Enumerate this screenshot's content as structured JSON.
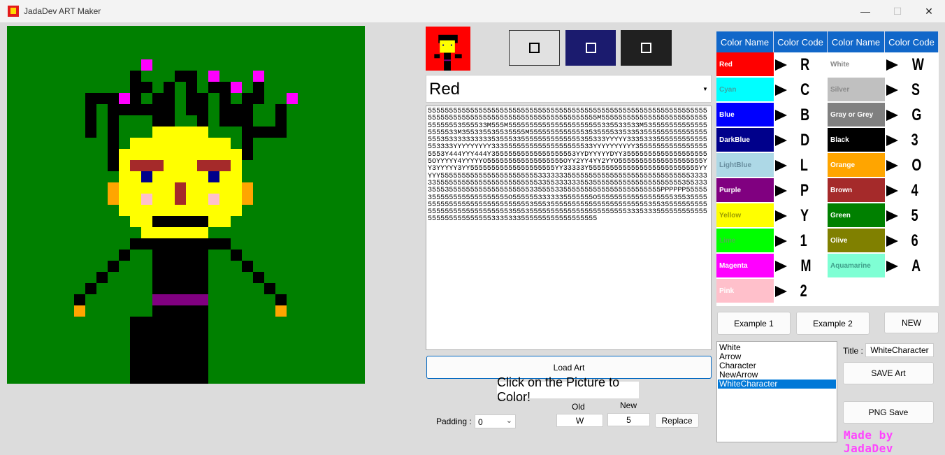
{
  "window": {
    "title": "JadaDev ART Maker",
    "controls": {
      "minimize": "—",
      "maximize": "☐",
      "close": "✕"
    }
  },
  "art": {
    "title": "WhiteCharacter",
    "background_color": "#008000",
    "code": "5555555555555555555555555555555555555555555555555555555555555555555555555555555555555555555555555555555555M555555555555555555555555555555553555533M555M5555555555555555555555335533533M5355555555555555555533M355335535535555M555555555555535355553353353555555555555555555353333333333535553355555555555555355333YYYYY3335333555555555555553333YYYYYYYYY333555555555555555555533YYYYYYYYYY355555555555555555553Y444YYY444Y35555555555555555553YYDYYYYYDYY355555555555555555555OYYYYY4YYYYYO555555555555555555OYY2YY4YY2YYO55555555555555555555YY3YYYYY3YY55555555555555555555YY33333Y55555555555555555555555555YYYYY5555555555555555555555533333335555555555555555555555555555533333355555555555555555555555533553333335535555555555555555555553553333555355555555555555555553355553355555555555555555555555PPPPPP555553555555555555555555O5555553333335555555O555555555555555555355355555555555555555555555555553555355555555555555555555555355355555555555555555555555555555355535555555555555555555555533353335555555555555555555555555553335333555555555555555555"
  },
  "current_color": "Red",
  "buttons": {
    "load_art": "Load Art",
    "example1": "Example 1",
    "example2": "Example 2",
    "new": "NEW",
    "save_art": "SAVE Art",
    "png_save": "PNG Save",
    "replace": "Replace"
  },
  "hint": "Click on the Picture to Color!",
  "padding": {
    "label": "Padding :",
    "value": "0"
  },
  "replace_fields": {
    "old_label": "Old",
    "old_value": "W",
    "new_label": "New",
    "new_value": "5"
  },
  "title_field": {
    "label": "Title :",
    "value": "WhiteCharacter"
  },
  "saved_list": [
    "White",
    "Arrow",
    "Character",
    "NewArrow",
    "WhiteCharacter"
  ],
  "selected_list_item": "WhiteCharacter",
  "palette_headers": [
    "Color Name",
    "Color Code",
    "Color Name",
    "Color Code"
  ],
  "palette_left": [
    {
      "name": "Red",
      "code": "R",
      "bg": "#ff0000",
      "fg": "#ffffff"
    },
    {
      "name": "Cyan",
      "code": "C",
      "bg": "#00ffff",
      "fg": "#3aa7a7"
    },
    {
      "name": "Blue",
      "code": "B",
      "bg": "#0000ff",
      "fg": "#ffffff"
    },
    {
      "name": "DarkBlue",
      "code": "D",
      "bg": "#00008b",
      "fg": "#ffffff"
    },
    {
      "name": "LightBlue",
      "code": "L",
      "bg": "#add8e6",
      "fg": "#6a8fa0"
    },
    {
      "name": "Purple",
      "code": "P",
      "bg": "#800080",
      "fg": "#ffffff"
    },
    {
      "name": "Yellow",
      "code": "Y",
      "bg": "#ffff00",
      "fg": "#9b9b00"
    },
    {
      "name": "Lime",
      "code": "1",
      "bg": "#00ff00",
      "fg": "#52b052"
    },
    {
      "name": "Magenta",
      "code": "M",
      "bg": "#ff00ff",
      "fg": "#ffffff"
    },
    {
      "name": "Pink",
      "code": "2",
      "bg": "#ffc0cb",
      "fg": "#ffffff"
    }
  ],
  "palette_right": [
    {
      "name": "White",
      "code": "W",
      "bg": "#ffffff",
      "fg": "#888888"
    },
    {
      "name": "Silver",
      "code": "S",
      "bg": "#c0c0c0",
      "fg": "#8a8a8a"
    },
    {
      "name": "Gray or Grey",
      "code": "G",
      "bg": "#808080",
      "fg": "#ffffff"
    },
    {
      "name": "Black",
      "code": "3",
      "bg": "#000000",
      "fg": "#ffffff"
    },
    {
      "name": "Orange",
      "code": "O",
      "bg": "#ffa500",
      "fg": "#ffffff"
    },
    {
      "name": "Brown",
      "code": "4",
      "bg": "#a52a2a",
      "fg": "#ffffff"
    },
    {
      "name": "Green",
      "code": "5",
      "bg": "#008000",
      "fg": "#ffffff"
    },
    {
      "name": "Olive",
      "code": "6",
      "bg": "#808000",
      "fg": "#ffffff"
    },
    {
      "name": "Aquamarine",
      "code": "A",
      "bg": "#7fffd4",
      "fg": "#3fa08a"
    }
  ],
  "credit": "Made by JadaDev",
  "colors": {
    "accent": "#1167c9",
    "selection": "#0078d7",
    "credit": "#ff44ff"
  }
}
